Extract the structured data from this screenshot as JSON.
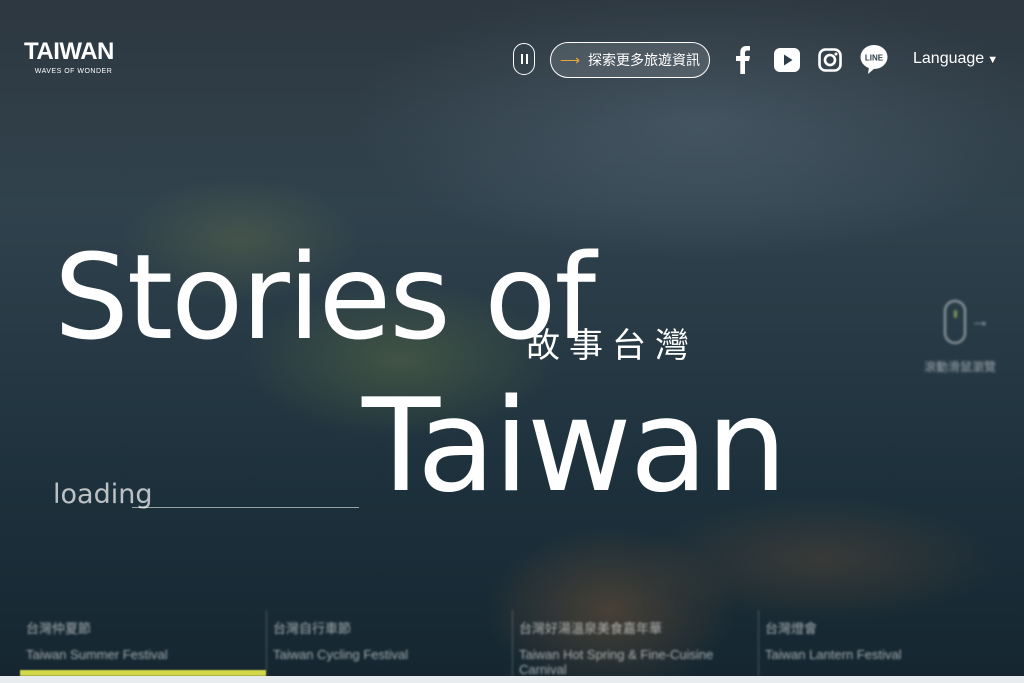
{
  "brand": {
    "logo_text": "TAIWAN",
    "tagline": "WAVES OF WONDER"
  },
  "header": {
    "explore_label": "探索更多旅遊資訊",
    "language_label": "Language",
    "accent_color": "#e8a640"
  },
  "hero": {
    "title_line1": "Stories of",
    "title_zh": "故事台灣",
    "title_line2": "Taiwan",
    "loading_label": "loading",
    "scroll_hint": "滾動滑鼠瀏覽"
  },
  "festivals": [
    {
      "zh": "台灣仲夏節",
      "en": "Taiwan Summer Festival",
      "active": true
    },
    {
      "zh": "台灣自行車節",
      "en": "Taiwan Cycling Festival",
      "active": false
    },
    {
      "zh": "台灣好湯溫泉美食嘉年華",
      "en": "Taiwan Hot Spring & Fine-Cuisine Carnival",
      "active": false
    },
    {
      "zh": "台灣燈會",
      "en": "Taiwan Lantern Festival",
      "active": false
    }
  ],
  "colors": {
    "active_bar": "#d2d84a"
  }
}
